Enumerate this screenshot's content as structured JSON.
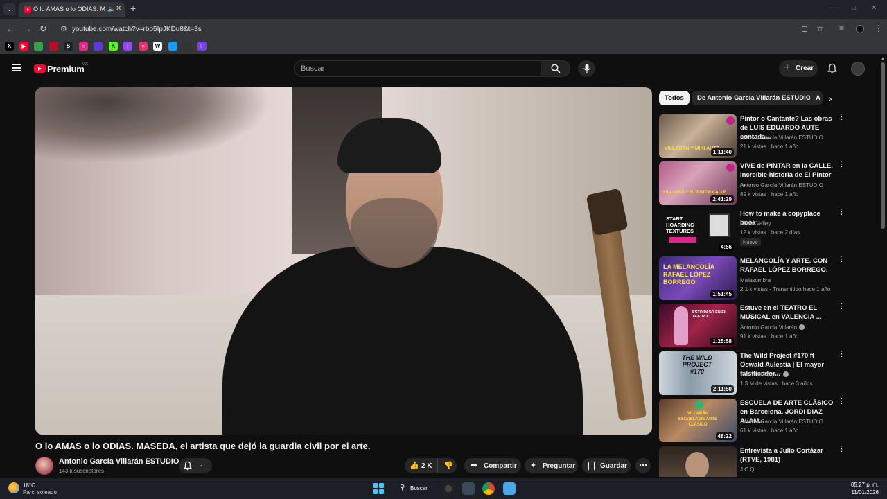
{
  "browser": {
    "tab_title": "O lo AMAS o lo ODIAS. MA",
    "url": "youtube.com/watch?v=rbo5IpJKDu8&t=3s"
  },
  "masthead": {
    "logo_text": "Premium",
    "country": "MX",
    "search_placeholder": "Buscar",
    "create_label": "Crear"
  },
  "video": {
    "title": "O lo AMAS o lo ODIAS. MASEDA, el artista que dejó la guardia civil por el arte.",
    "channel": "Antonio García Villarán ESTUDIO",
    "subscribers": "143 k suscriptores",
    "likes": "2 K",
    "share_label": "Compartir",
    "ask_label": "Preguntar",
    "save_label": "Guardar"
  },
  "chips": [
    {
      "label": "Todos"
    },
    {
      "label": "De Antonio García Villarán ESTUDIO"
    },
    {
      "label": "A"
    }
  ],
  "recommendations": [
    {
      "title": "Pintor o Cantante? Las obras de LUIS EDUARDO AUTE contada...",
      "channel": "Antonio García Villarán ESTUDIO",
      "meta": "21 k vistas · hace 1 año",
      "duration": "1:11:40",
      "badge": ""
    },
    {
      "title": "VIVE de PINTAR en la CALLE. Increíble historia de El Pintor ...",
      "channel": "Antonio García Villarán ESTUDIO",
      "meta": "89 k vistas · hace 1 año",
      "duration": "2:41:29",
      "badge": ""
    },
    {
      "title": "How to make a copyplace book",
      "channel": "Alfred Valley",
      "meta": "12 k vistas · hace 2 días",
      "duration": "4:56",
      "badge": "Nuevo"
    },
    {
      "title": "MELANCOLÍA Y ARTE. CON RAFAEL LÓPEZ BORREGO.",
      "channel": "Malasombra",
      "meta": "2.1 k vistas · Transmitido hace 1 año",
      "duration": "1:51:45",
      "badge": ""
    },
    {
      "title": "Estuve en el TEATRO EL MUSICAL en VALENCIA ...",
      "channel": "Antonio García Villarán",
      "meta": "91 k vistas · hace 1 año",
      "duration": "1:25:58",
      "badge": ""
    },
    {
      "title": "The Wild Project #170 ft Oswald Aulestia | El mayor falsificador...",
      "channel": "The Wild Project",
      "meta": "1.3 M de vistas · hace 3 años",
      "duration": "2:11:50",
      "badge": ""
    },
    {
      "title": "ESCUELA DE ARTE CLÁSICO en Barcelona. JORDI DIAZ ALAM...",
      "channel": "Antonio García Villarán ESTUDIO",
      "meta": "61 k vistas · hace 1 año",
      "duration": "48:22",
      "badge": ""
    },
    {
      "title": "Entrevista a Julio Cortázar (RTVE, 1981)",
      "channel": "J.C.Q.",
      "meta": "",
      "duration": "",
      "badge": ""
    }
  ],
  "thumb_text": {
    "t1": "VILLARÁN Y MIKI AUTE",
    "t2": "VILLARÁN Y EL PINTOR CALLE",
    "t3": "START HOARDING TEXTURES",
    "t4": "LA MELANCOLÍA RAFAEL LÓPEZ BORREGO",
    "t5": "ESTO PASÓ EN EL TEATRO...",
    "t6": "THE WILD PROJECT #170",
    "t7": "VILLARÁN ESCUELA DE ARTE CLÁSICO"
  },
  "taskbar": {
    "temperature": "18°C",
    "weather": "Parc. soleado",
    "search_label": "Buscar",
    "time": "05:27 p. m.",
    "date": "11/01/2026"
  },
  "colors": {
    "youtube_red": "#ff0033",
    "background": "#0f0f0f",
    "chip_bg": "#272727"
  }
}
